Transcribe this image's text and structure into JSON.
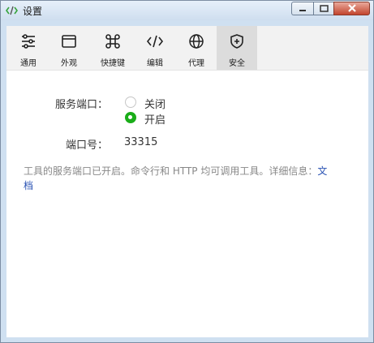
{
  "window": {
    "title": "设置"
  },
  "toolbar": {
    "items": [
      {
        "label": "通用",
        "icon": "sliders-icon"
      },
      {
        "label": "外观",
        "icon": "window-icon"
      },
      {
        "label": "快捷键",
        "icon": "command-key-icon"
      },
      {
        "label": "编辑",
        "icon": "code-icon"
      },
      {
        "label": "代理",
        "icon": "globe-icon"
      },
      {
        "label": "安全",
        "icon": "shield-plus-icon"
      }
    ],
    "active": "安全"
  },
  "service_port": {
    "label": "服务端口：",
    "options": [
      {
        "label": "关闭",
        "selected": false
      },
      {
        "label": "开启",
        "selected": true
      }
    ]
  },
  "port_number": {
    "label": "端口号：",
    "value": "33315"
  },
  "note": {
    "text": "工具的服务端口已开启。命令行和 HTTP 均可调用工具。详细信息：",
    "link": "文档"
  },
  "colors": {
    "accent": "#1aad19",
    "link": "#2952b3"
  }
}
